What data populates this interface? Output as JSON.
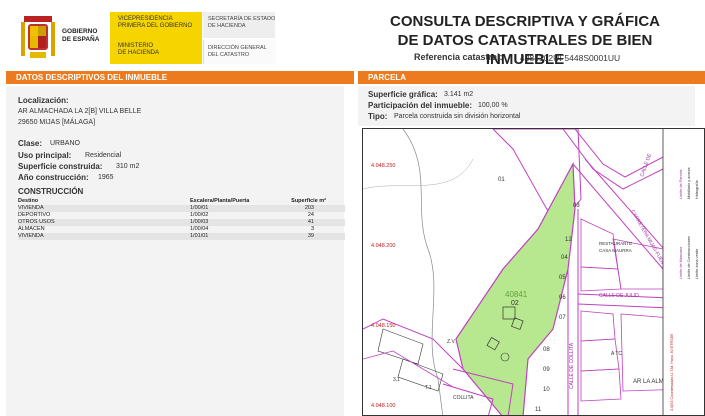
{
  "header": {
    "gobierno": [
      "GOBIERNO",
      "DE ESPAÑA"
    ],
    "vicepresidencia": [
      "VICEPRESIDENCIA",
      "PRIMERA DEL GOBIERNO"
    ],
    "ministerio": [
      "MINISTERIO",
      "DE HACIENDA"
    ],
    "secretaria": [
      "SECRETARÍA DE ESTADO",
      "DE HACIENDA"
    ],
    "direccion": [
      "DIRECCIÓN GENERAL",
      "DEL CATASTRO"
    ],
    "title_line1": "CONSULTA DESCRIPTIVA Y GRÁFICA",
    "title_line2": "DE DATOS CATASTRALES DE BIEN INMUEBLE",
    "ref_label": "Referencia catastral:",
    "ref_value": "4084102UF5448S0001UU"
  },
  "left": {
    "bar": "DATOS DESCRIPTIVOS DEL INMUEBLE",
    "localizacion_label": "Localización:",
    "loc_line1": "AR ALMACHADA LA 2[B] VILLA BELLE",
    "loc_line2": "29650 MIJAS [MÁLAGA]",
    "clase_label": "Clase:",
    "clase_value": "URBANO",
    "uso_label": "Uso principal:",
    "uso_value": "Residencial",
    "sup_label": "Superficie construida:",
    "sup_value": "310 m2",
    "anio_label": "Año construcción:",
    "anio_value": "1965",
    "construccion_label": "CONSTRUCCIÓN",
    "table_headers": [
      "Destino",
      "Escalera/Planta/Puerta",
      "Superficie m²"
    ],
    "rows": [
      [
        "VIVIENDA",
        "1/00/01",
        "203"
      ],
      [
        "DEPORTIVO",
        "1/00/02",
        "24"
      ],
      [
        "OTROS USOS",
        "1/00/03",
        "41"
      ],
      [
        "ALMACEN",
        "1/00/04",
        "3"
      ],
      [
        "VIVIENDA",
        "1/01/01",
        "39"
      ]
    ]
  },
  "right": {
    "bar": "PARCELA",
    "supg_label": "Superficie gráfica:",
    "supg_value": "3.141 m2",
    "part_label": "Participación del inmueble:",
    "part_value": "100,00 %",
    "tipo_label": "Tipo:",
    "tipo_value": "Parcela construida sin división horizontal"
  },
  "map": {
    "y_labels": [
      "4.048.250",
      "4.048.200",
      "4.048.150",
      "4.048.100"
    ],
    "parcel_labels": [
      "01",
      "03",
      "12",
      "04",
      "05",
      "06",
      "07",
      "08",
      "09",
      "10",
      "11",
      "02"
    ],
    "parcel_id": "40841",
    "street_labels": [
      "CALLE DE",
      "CARRETERA MIJAS-FUENGIROLA",
      "CALLE DE JULIO",
      "CALLE DE COLLITA",
      "AR LA ALMA"
    ],
    "restaurant": [
      "RESTAURANTE",
      "CASA MAURRA"
    ],
    "misc": [
      "Z.V.",
      "T.1",
      "A TC",
      "COLLITA",
      "3,1"
    ],
    "legend_col1": "3.0|53 Coordenadas U.T.M. Huso 30 ETRS89",
    "legend_col2a": "Límite de Manzana",
    "legend_col2b": "Límite de Parcela",
    "legend_col3a": "Límite de Construcciones",
    "legend_col3b": "Mobiliario y aceras",
    "legend_col4a": "Límite zona verde",
    "legend_col4b": "Hidrografía"
  },
  "colors": {
    "accent": "#ec7a1e",
    "gov_yellow": "#f5d400",
    "parcel_green": "#b7e88f",
    "manzana": "#c040c0"
  }
}
